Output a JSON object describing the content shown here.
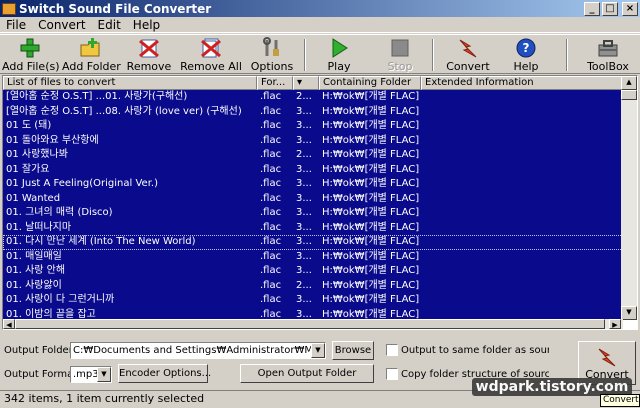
{
  "window": {
    "title": "Switch Sound File Converter"
  },
  "menu": [
    "File",
    "Convert",
    "Edit",
    "Help"
  ],
  "toolbar": [
    {
      "label": "Add File(s)",
      "icon": "add-file-icon"
    },
    {
      "label": "Add Folder",
      "icon": "add-folder-icon"
    },
    {
      "label": "Remove",
      "icon": "remove-icon"
    },
    {
      "label": "Remove All",
      "icon": "remove-all-icon"
    },
    {
      "label": "Options",
      "icon": "options-icon"
    },
    {
      "label": "Play",
      "icon": "play-icon"
    },
    {
      "label": "Stop",
      "icon": "stop-icon",
      "disabled": true
    },
    {
      "label": "Convert",
      "icon": "convert-icon"
    },
    {
      "label": "Help",
      "icon": "help-icon"
    },
    {
      "label": "ToolBox",
      "icon": "toolbox-icon"
    }
  ],
  "list": {
    "columns": [
      "List of files to convert",
      "For...",
      "",
      "Containing Folder",
      "Extended Information"
    ],
    "rows": [
      {
        "name": "[열아홉 순정 O.S.T] ...01. 사랑가(구해선)",
        "format": ".flac",
        "size": "2...",
        "folder": "H:₩ok₩[개별 FLAC]"
      },
      {
        "name": "[열아홉 순정 O.S.T] ...08. 사랑가 (love ver) (구해선)",
        "format": ".flac",
        "size": "3...",
        "folder": "H:₩ok₩[개별 FLAC]"
      },
      {
        "name": "01 도 (돼)",
        "format": ".flac",
        "size": "3...",
        "folder": "H:₩ok₩[개별 FLAC]"
      },
      {
        "name": "01 돌아와요 부산항에",
        "format": ".flac",
        "size": "3...",
        "folder": "H:₩ok₩[개별 FLAC]"
      },
      {
        "name": "01 사랑했나봐",
        "format": ".flac",
        "size": "2...",
        "folder": "H:₩ok₩[개별 FLAC]"
      },
      {
        "name": "01 잘가요",
        "format": ".flac",
        "size": "3...",
        "folder": "H:₩ok₩[개별 FLAC]"
      },
      {
        "name": "01 Just A Feeling(Original Ver.)",
        "format": ".flac",
        "size": "3...",
        "folder": "H:₩ok₩[개별 FLAC]"
      },
      {
        "name": "01 Wanted",
        "format": ".flac",
        "size": "3...",
        "folder": "H:₩ok₩[개별 FLAC]"
      },
      {
        "name": "01. 그녀의 매력 (Disco)",
        "format": ".flac",
        "size": "3...",
        "folder": "H:₩ok₩[개별 FLAC]"
      },
      {
        "name": "01. 날떠나지마",
        "format": ".flac",
        "size": "3...",
        "folder": "H:₩ok₩[개별 FLAC]"
      },
      {
        "name": "01. 다시 만난 세계 (Into The New World)",
        "format": ".flac",
        "size": "3...",
        "folder": "H:₩ok₩[개별 FLAC]",
        "focus": true
      },
      {
        "name": "01. 매일매일",
        "format": ".flac",
        "size": "3...",
        "folder": "H:₩ok₩[개별 FLAC]"
      },
      {
        "name": "01. 사랑 안해",
        "format": ".flac",
        "size": "3...",
        "folder": "H:₩ok₩[개별 FLAC]"
      },
      {
        "name": "01. 사랑앓이",
        "format": ".flac",
        "size": "2...",
        "folder": "H:₩ok₩[개별 FLAC]"
      },
      {
        "name": "01. 사랑이 다 그런거니까",
        "format": ".flac",
        "size": "3...",
        "folder": "H:₩ok₩[개별 FLAC]"
      },
      {
        "name": "01. 이밤의 끝을 잡고",
        "format": ".flac",
        "size": "3...",
        "folder": "H:₩ok₩[개별 FLAC]"
      }
    ]
  },
  "bottom": {
    "output_folder_label": "Output Folder",
    "output_folder_value": "C:₩Documents and Settings₩Administrator₩My Documer",
    "browse_label": "Browse",
    "same_folder_label": "Output to same folder as source files",
    "output_format_label": "Output Format",
    "output_format_value": ".mp3",
    "encoder_options_label": "Encoder Options...",
    "open_output_folder_label": "Open Output Folder",
    "copy_structure_label": "Copy folder structure of source files",
    "convert_label": "Convert"
  },
  "status": {
    "text": "342 items, 1 item currently selected"
  },
  "watermark": "wdpark.tistory.com",
  "tooltip": "Convert"
}
